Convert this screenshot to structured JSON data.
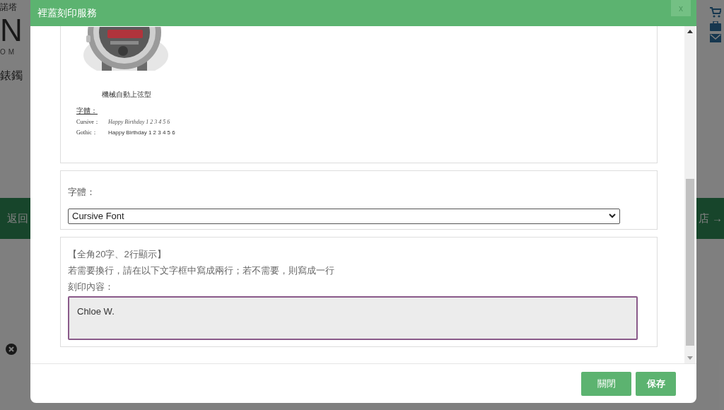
{
  "background_page": {
    "brand_top": "諾塔",
    "logo": "N",
    "logo_sub": "OM",
    "heading": "錶鐲",
    "back_link": "返回",
    "shop_link": "店 →"
  },
  "modal": {
    "title": "裡蓋刻印服務",
    "close": "x",
    "image_card": {
      "caption": "機械自動上弦型",
      "font_heading": "字體：",
      "samples": [
        {
          "label": "Cursive：",
          "text": "Happy Birthday 1 2 3 4 5 6",
          "kind": "cursive"
        },
        {
          "label": "Gothic：",
          "text": "Happy Birthday  1 2 3 4 5 6",
          "kind": "gothic"
        }
      ]
    },
    "font_card": {
      "label": "字體：",
      "select": {
        "value": "Cursive Font"
      }
    },
    "text_card": {
      "lines": [
        "【全角20字、2行顯示】",
        "若需要換行，請在以下文字框中寫成兩行；若不需要，則寫成一行",
        "刻印內容："
      ],
      "textarea": {
        "value": "Chloe W."
      }
    },
    "buttons": [
      "關閉",
      "保存"
    ]
  }
}
